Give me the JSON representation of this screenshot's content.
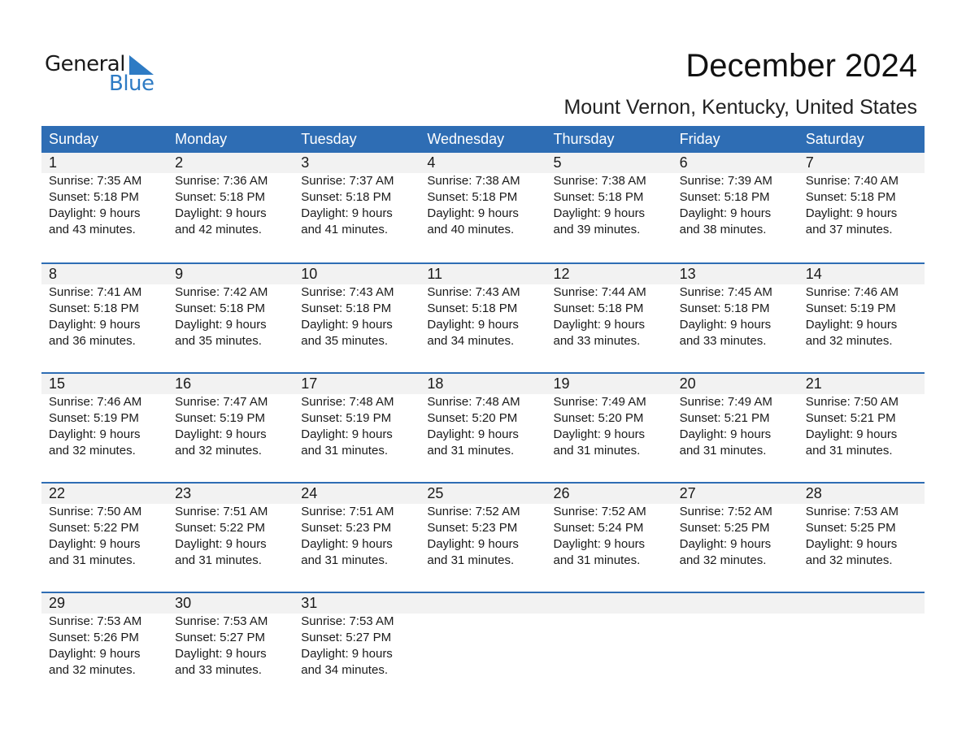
{
  "logo": {
    "line1": "General",
    "line2": "Blue"
  },
  "header": {
    "title": "December 2024",
    "location": "Mount Vernon, Kentucky, United States"
  },
  "colors": {
    "header_bg": "#2E6DB4",
    "date_strip": "#F2F2F2",
    "logo_blue": "#2E7BC4"
  },
  "weekdays": [
    "Sunday",
    "Monday",
    "Tuesday",
    "Wednesday",
    "Thursday",
    "Friday",
    "Saturday"
  ],
  "weeks": [
    [
      {
        "day": "1",
        "sunrise": "Sunrise: 7:35 AM",
        "sunset": "Sunset: 5:18 PM",
        "daylight1": "Daylight: 9 hours",
        "daylight2": "and 43 minutes."
      },
      {
        "day": "2",
        "sunrise": "Sunrise: 7:36 AM",
        "sunset": "Sunset: 5:18 PM",
        "daylight1": "Daylight: 9 hours",
        "daylight2": "and 42 minutes."
      },
      {
        "day": "3",
        "sunrise": "Sunrise: 7:37 AM",
        "sunset": "Sunset: 5:18 PM",
        "daylight1": "Daylight: 9 hours",
        "daylight2": "and 41 minutes."
      },
      {
        "day": "4",
        "sunrise": "Sunrise: 7:38 AM",
        "sunset": "Sunset: 5:18 PM",
        "daylight1": "Daylight: 9 hours",
        "daylight2": "and 40 minutes."
      },
      {
        "day": "5",
        "sunrise": "Sunrise: 7:38 AM",
        "sunset": "Sunset: 5:18 PM",
        "daylight1": "Daylight: 9 hours",
        "daylight2": "and 39 minutes."
      },
      {
        "day": "6",
        "sunrise": "Sunrise: 7:39 AM",
        "sunset": "Sunset: 5:18 PM",
        "daylight1": "Daylight: 9 hours",
        "daylight2": "and 38 minutes."
      },
      {
        "day": "7",
        "sunrise": "Sunrise: 7:40 AM",
        "sunset": "Sunset: 5:18 PM",
        "daylight1": "Daylight: 9 hours",
        "daylight2": "and 37 minutes."
      }
    ],
    [
      {
        "day": "8",
        "sunrise": "Sunrise: 7:41 AM",
        "sunset": "Sunset: 5:18 PM",
        "daylight1": "Daylight: 9 hours",
        "daylight2": "and 36 minutes."
      },
      {
        "day": "9",
        "sunrise": "Sunrise: 7:42 AM",
        "sunset": "Sunset: 5:18 PM",
        "daylight1": "Daylight: 9 hours",
        "daylight2": "and 35 minutes."
      },
      {
        "day": "10",
        "sunrise": "Sunrise: 7:43 AM",
        "sunset": "Sunset: 5:18 PM",
        "daylight1": "Daylight: 9 hours",
        "daylight2": "and 35 minutes."
      },
      {
        "day": "11",
        "sunrise": "Sunrise: 7:43 AM",
        "sunset": "Sunset: 5:18 PM",
        "daylight1": "Daylight: 9 hours",
        "daylight2": "and 34 minutes."
      },
      {
        "day": "12",
        "sunrise": "Sunrise: 7:44 AM",
        "sunset": "Sunset: 5:18 PM",
        "daylight1": "Daylight: 9 hours",
        "daylight2": "and 33 minutes."
      },
      {
        "day": "13",
        "sunrise": "Sunrise: 7:45 AM",
        "sunset": "Sunset: 5:18 PM",
        "daylight1": "Daylight: 9 hours",
        "daylight2": "and 33 minutes."
      },
      {
        "day": "14",
        "sunrise": "Sunrise: 7:46 AM",
        "sunset": "Sunset: 5:19 PM",
        "daylight1": "Daylight: 9 hours",
        "daylight2": "and 32 minutes."
      }
    ],
    [
      {
        "day": "15",
        "sunrise": "Sunrise: 7:46 AM",
        "sunset": "Sunset: 5:19 PM",
        "daylight1": "Daylight: 9 hours",
        "daylight2": "and 32 minutes."
      },
      {
        "day": "16",
        "sunrise": "Sunrise: 7:47 AM",
        "sunset": "Sunset: 5:19 PM",
        "daylight1": "Daylight: 9 hours",
        "daylight2": "and 32 minutes."
      },
      {
        "day": "17",
        "sunrise": "Sunrise: 7:48 AM",
        "sunset": "Sunset: 5:19 PM",
        "daylight1": "Daylight: 9 hours",
        "daylight2": "and 31 minutes."
      },
      {
        "day": "18",
        "sunrise": "Sunrise: 7:48 AM",
        "sunset": "Sunset: 5:20 PM",
        "daylight1": "Daylight: 9 hours",
        "daylight2": "and 31 minutes."
      },
      {
        "day": "19",
        "sunrise": "Sunrise: 7:49 AM",
        "sunset": "Sunset: 5:20 PM",
        "daylight1": "Daylight: 9 hours",
        "daylight2": "and 31 minutes."
      },
      {
        "day": "20",
        "sunrise": "Sunrise: 7:49 AM",
        "sunset": "Sunset: 5:21 PM",
        "daylight1": "Daylight: 9 hours",
        "daylight2": "and 31 minutes."
      },
      {
        "day": "21",
        "sunrise": "Sunrise: 7:50 AM",
        "sunset": "Sunset: 5:21 PM",
        "daylight1": "Daylight: 9 hours",
        "daylight2": "and 31 minutes."
      }
    ],
    [
      {
        "day": "22",
        "sunrise": "Sunrise: 7:50 AM",
        "sunset": "Sunset: 5:22 PM",
        "daylight1": "Daylight: 9 hours",
        "daylight2": "and 31 minutes."
      },
      {
        "day": "23",
        "sunrise": "Sunrise: 7:51 AM",
        "sunset": "Sunset: 5:22 PM",
        "daylight1": "Daylight: 9 hours",
        "daylight2": "and 31 minutes."
      },
      {
        "day": "24",
        "sunrise": "Sunrise: 7:51 AM",
        "sunset": "Sunset: 5:23 PM",
        "daylight1": "Daylight: 9 hours",
        "daylight2": "and 31 minutes."
      },
      {
        "day": "25",
        "sunrise": "Sunrise: 7:52 AM",
        "sunset": "Sunset: 5:23 PM",
        "daylight1": "Daylight: 9 hours",
        "daylight2": "and 31 minutes."
      },
      {
        "day": "26",
        "sunrise": "Sunrise: 7:52 AM",
        "sunset": "Sunset: 5:24 PM",
        "daylight1": "Daylight: 9 hours",
        "daylight2": "and 31 minutes."
      },
      {
        "day": "27",
        "sunrise": "Sunrise: 7:52 AM",
        "sunset": "Sunset: 5:25 PM",
        "daylight1": "Daylight: 9 hours",
        "daylight2": "and 32 minutes."
      },
      {
        "day": "28",
        "sunrise": "Sunrise: 7:53 AM",
        "sunset": "Sunset: 5:25 PM",
        "daylight1": "Daylight: 9 hours",
        "daylight2": "and 32 minutes."
      }
    ],
    [
      {
        "day": "29",
        "sunrise": "Sunrise: 7:53 AM",
        "sunset": "Sunset: 5:26 PM",
        "daylight1": "Daylight: 9 hours",
        "daylight2": "and 32 minutes."
      },
      {
        "day": "30",
        "sunrise": "Sunrise: 7:53 AM",
        "sunset": "Sunset: 5:27 PM",
        "daylight1": "Daylight: 9 hours",
        "daylight2": "and 33 minutes."
      },
      {
        "day": "31",
        "sunrise": "Sunrise: 7:53 AM",
        "sunset": "Sunset: 5:27 PM",
        "daylight1": "Daylight: 9 hours",
        "daylight2": "and 34 minutes."
      },
      null,
      null,
      null,
      null
    ]
  ]
}
